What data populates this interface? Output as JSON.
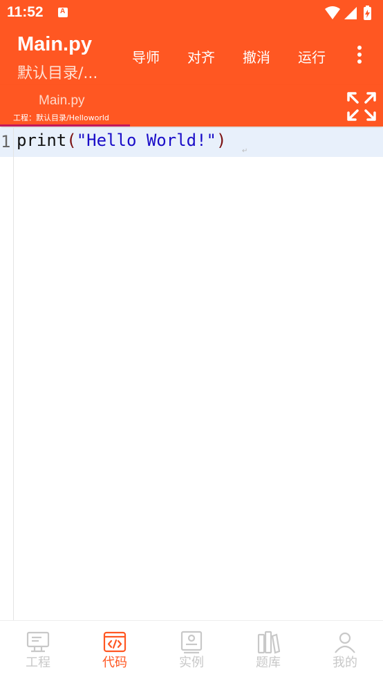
{
  "status": {
    "time": "11:52",
    "notif_letter": "A"
  },
  "appbar": {
    "title": "Main.py",
    "subtitle": "默认目录/...",
    "actions": [
      "导师",
      "对齐",
      "撤消",
      "运行"
    ]
  },
  "tab": {
    "name": "Main.py",
    "path": "工程：默认目录/Helloworld"
  },
  "editor": {
    "line_number": "1",
    "code": {
      "fn": "print",
      "open": "(",
      "str": "\"Hello World!\"",
      "close": ")"
    },
    "eol_marker": "↵"
  },
  "nav": {
    "items": [
      "工程",
      "代码",
      "实例",
      "题库",
      "我的"
    ],
    "active_index": 1
  },
  "colors": {
    "primary": "#FF5722",
    "tab_indicator": "#C2185B",
    "line_highlight": "#E8F0FB",
    "string": "#1A0DC8"
  }
}
